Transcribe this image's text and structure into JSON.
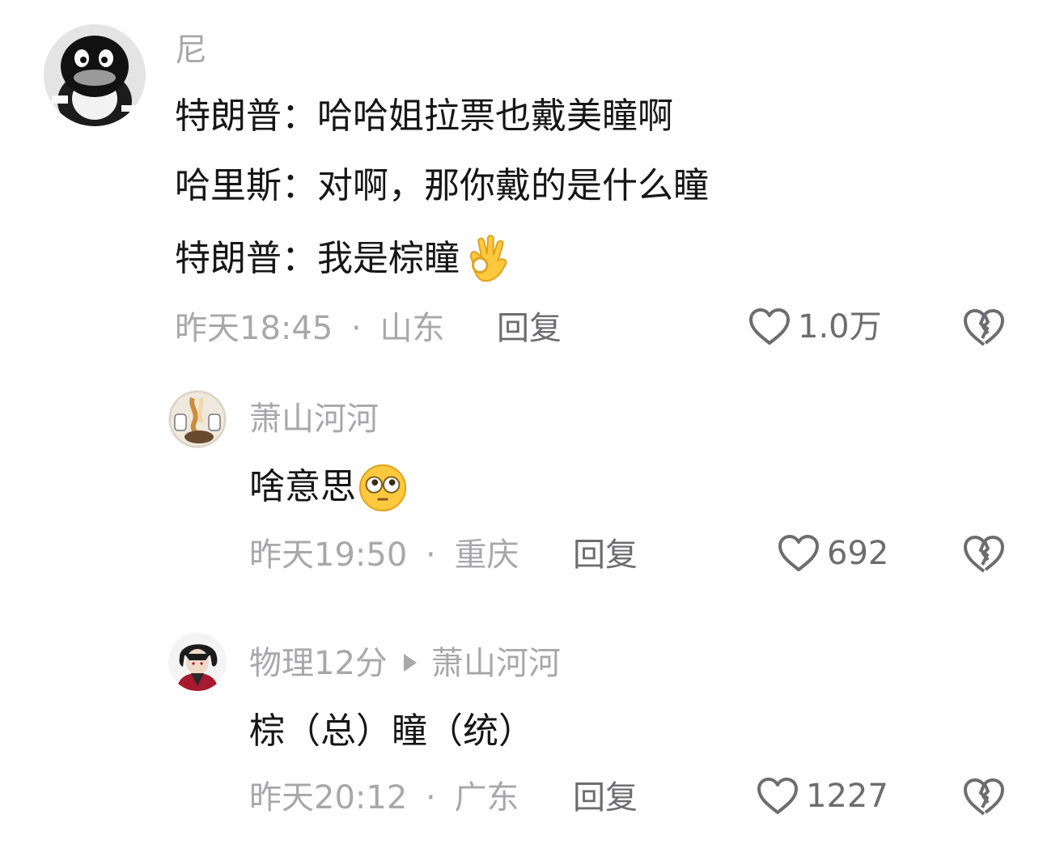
{
  "comments": [
    {
      "username": "尼",
      "lines": [
        "特朗普：哈哈姐拉票也戴美瞳啊",
        "哈里斯：对啊，那你戴的是什么瞳",
        "特朗普：我是棕瞳"
      ],
      "emoji_icon": "ok-hand-emoji",
      "time": "昨天18:45",
      "location": "山东",
      "separator": "·",
      "reply_label": "回复",
      "likes": "1.0万"
    },
    {
      "username": "萧山河河",
      "lines": [
        "啥意思"
      ],
      "emoji_icon": "flushed-face-emoji",
      "time": "昨天19:50",
      "location": "重庆",
      "separator": "·",
      "reply_label": "回复",
      "likes": "692"
    },
    {
      "username": "物理12分",
      "reply_to": "萧山河河",
      "lines": [
        "棕（总）瞳（统）"
      ],
      "time": "昨天20:12",
      "location": "广东",
      "separator": "·",
      "reply_label": "回复",
      "likes": "1227"
    }
  ],
  "icons": {
    "like": "heart-outline-icon",
    "dislike": "broken-heart-icon",
    "reply_arrow": "triangle-right-icon"
  },
  "colors": {
    "background": "#ffffff",
    "text": "#161616",
    "muted": "#a8a8ab",
    "action": "#6d6d70",
    "emoji_yellow": "#ffc83d"
  }
}
